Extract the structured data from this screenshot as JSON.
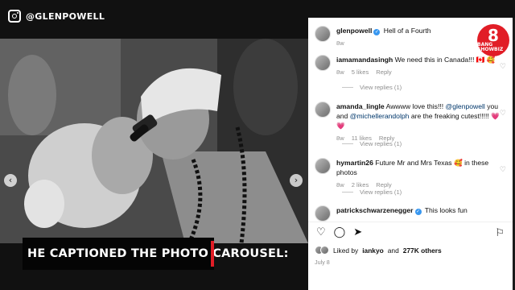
{
  "overlay": {
    "handle": "@GLENPOWELL",
    "caption": "HE CAPTIONED THE PHOTO CAROUSEL:"
  },
  "brand": {
    "number": "8",
    "name": "BANG SHOWBIZ",
    "color": "#e11d26"
  },
  "post": {
    "author": "glenpowell",
    "caption": "Hell of a Fourth",
    "time": "8w"
  },
  "comments": [
    {
      "user": "iamamandasingh",
      "text": "We need this in Canada!!! 🇨🇦 🥰",
      "time": "8w",
      "likes": "5 likes",
      "reply": "Reply",
      "replies": "View replies (1)"
    },
    {
      "user": "amanda_lingle",
      "text_before": "Awwww love this!!! ",
      "mention1": "@glenpowell",
      "text_mid": " you and ",
      "mention2": "@michellerandolph",
      "text_after": " are the freaking cutest!!!!! 💗 💗",
      "time": "8w",
      "likes": "11 likes",
      "reply": "Reply",
      "replies": "View replies (1)"
    },
    {
      "user": "hymartin26",
      "text": "Future Mr and Mrs Texas 🥰 in these photos",
      "time": "8w",
      "likes": "2 likes",
      "reply": "Reply",
      "replies": "View replies (1)"
    },
    {
      "user": "patrickschwarzenegger",
      "text": "This looks fun"
    }
  ],
  "likes": {
    "prefix": "Liked by ",
    "user": "iankyo",
    "middle": " and ",
    "count": "277K others"
  },
  "date": "July 8",
  "icons": [
    "heart-icon",
    "comment-icon",
    "share-icon",
    "bookmark-icon",
    "chevron-left-icon",
    "chevron-right-icon",
    "instagram-icon",
    "verified-icon"
  ]
}
